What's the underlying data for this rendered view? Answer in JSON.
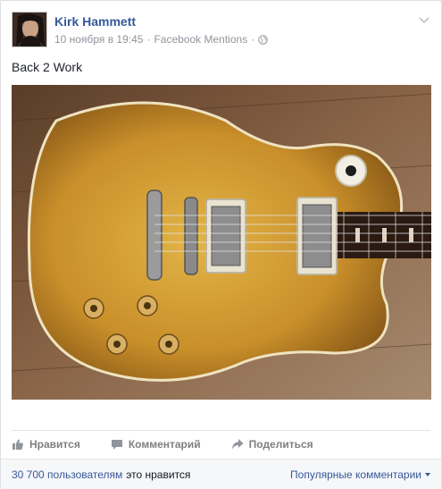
{
  "post": {
    "author": "Kirk Hammett",
    "date": "10 ноября в 19:45",
    "separator": "·",
    "source": "Facebook Mentions",
    "text": "Back 2 Work",
    "photo_alt": "Guitar photo"
  },
  "actions": {
    "like": "Нравится",
    "comment": "Комментарий",
    "share": "Поделиться"
  },
  "footer": {
    "likes_count": "30 700 пользователям",
    "likes_rest": "это нравится",
    "popular_comments": "Популярные комментарии"
  },
  "colors": {
    "link": "#365899",
    "muted": "#90949c",
    "action": "#7f7f7f"
  }
}
